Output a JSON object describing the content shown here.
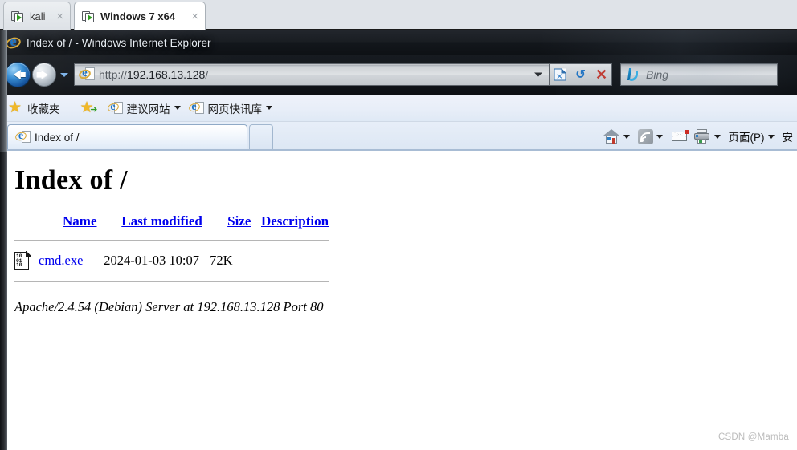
{
  "vm_tabs": [
    {
      "label": "kali",
      "icon": "vm-play-icon",
      "close": "×",
      "active": false
    },
    {
      "label": "Windows 7 x64",
      "icon": "vm-play-icon",
      "close": "×",
      "active": true
    }
  ],
  "browser": {
    "title": "Index of / - Windows Internet Explorer",
    "address": {
      "scheme": "http://",
      "host": "192.168.13.128",
      "path": "/",
      "full": "http://192.168.13.128/"
    },
    "nav": {
      "back_label": "Back",
      "forward_label": "Forward",
      "history_caret": "▼",
      "address_caret": "▼",
      "compat_label": "Compatibility View",
      "refresh_glyph": "↺",
      "stop_glyph": "✕"
    },
    "search": {
      "provider": "Bing",
      "placeholder": "Bing",
      "value": ""
    },
    "favorites_bar": {
      "favorites_label": "收藏夹",
      "items": [
        {
          "label": "建议网站",
          "caret": "▼"
        },
        {
          "label": "网页快讯库",
          "caret": "▼"
        }
      ]
    },
    "tabs": [
      {
        "label": "Index of /",
        "active": true
      }
    ],
    "new_tab_label": "",
    "command_bar": [
      {
        "name": "home",
        "label": "",
        "caret": "▼"
      },
      {
        "name": "feeds",
        "label": "",
        "caret": "▼"
      },
      {
        "name": "mail",
        "label": "",
        "caret": ""
      },
      {
        "name": "print",
        "label": "",
        "caret": "▼"
      },
      {
        "name": "page",
        "label": "页面(P)",
        "caret": "▼"
      },
      {
        "name": "safety",
        "label": "安",
        "caret": ""
      }
    ]
  },
  "page": {
    "heading": "Index of /",
    "columns": {
      "name": "Name",
      "last_modified": "Last modified",
      "size": "Size",
      "description": "Description"
    },
    "rows": [
      {
        "icon": "binary-file-icon",
        "icon_bits": "10\n01\n10",
        "name": "cmd.exe",
        "last_modified": "2024-01-03 10:07",
        "size": "72K",
        "description": ""
      }
    ],
    "signature": "Apache/2.4.54 (Debian) Server at 192.168.13.128 Port 80"
  },
  "watermark": "CSDN @Mamba",
  "colors": {
    "link": "#0000ee",
    "titlebar": "#12161b",
    "favbar": "#e8eef8",
    "tabrow": "#dde7f4",
    "vm_play_green": "#2f9c20"
  }
}
